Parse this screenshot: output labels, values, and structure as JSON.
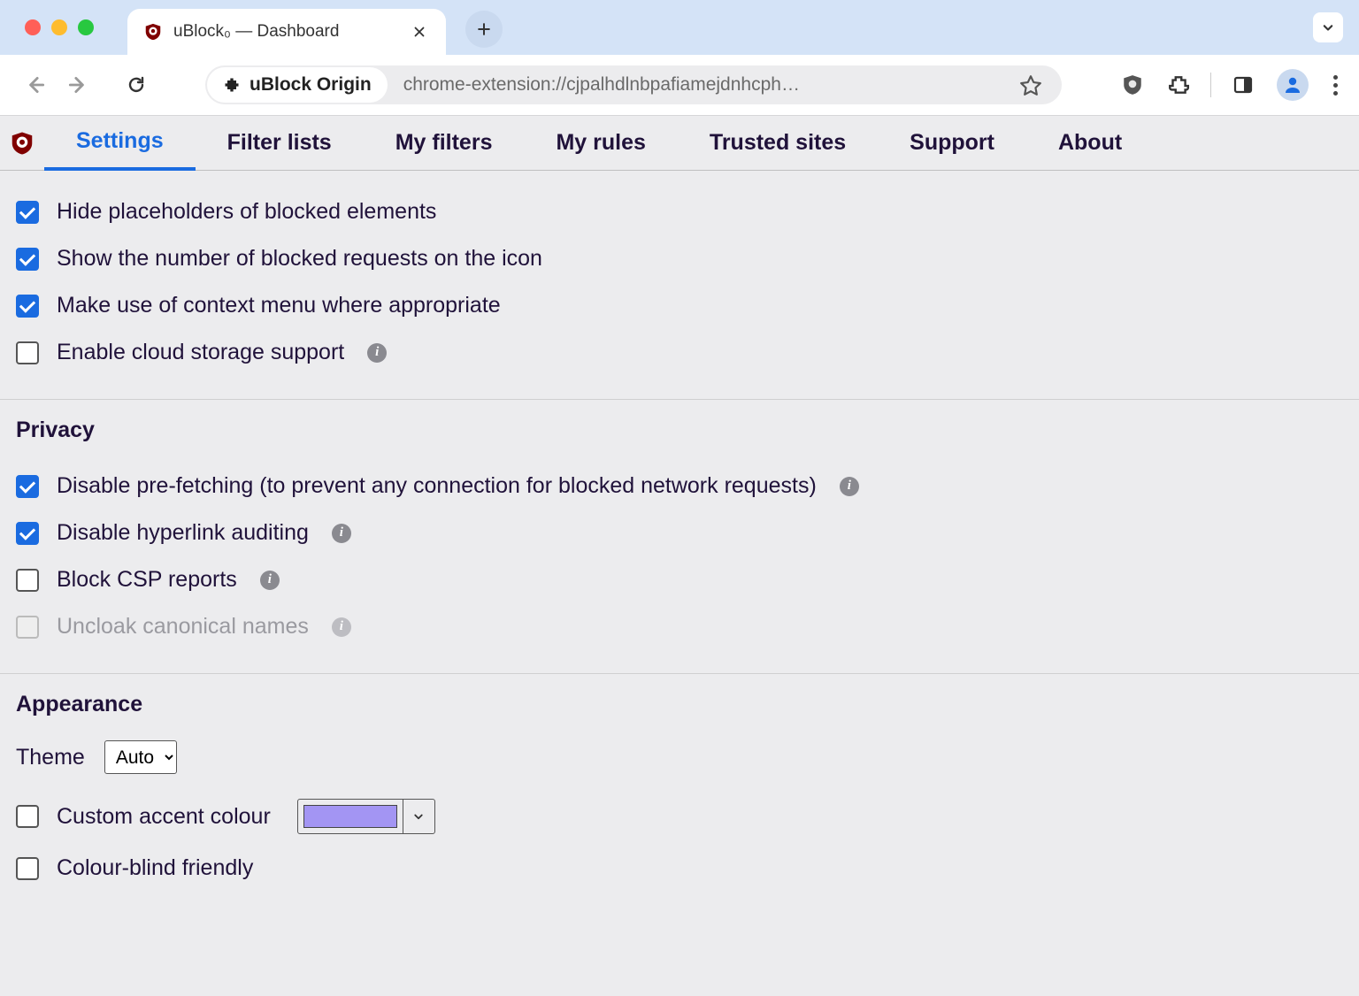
{
  "browser": {
    "tab_title": "uBlock₀ — Dashboard",
    "ext_chip_label": "uBlock Origin",
    "url": "chrome-extension://cjpalhdlnbpafiamejdnhcph…"
  },
  "dashboard": {
    "tabs": {
      "settings": "Settings",
      "filter_lists": "Filter lists",
      "my_filters": "My filters",
      "my_rules": "My rules",
      "trusted_sites": "Trusted sites",
      "support": "Support",
      "about": "About"
    }
  },
  "general": {
    "hide_placeholders": {
      "label": "Hide placeholders of blocked elements",
      "checked": true
    },
    "show_blocked_count": {
      "label": "Show the number of blocked requests on the icon",
      "checked": true
    },
    "context_menu": {
      "label": "Make use of context menu where appropriate",
      "checked": true
    },
    "cloud_storage": {
      "label": "Enable cloud storage support",
      "checked": false,
      "info": true
    }
  },
  "privacy": {
    "title": "Privacy",
    "disable_prefetching": {
      "label": "Disable pre-fetching (to prevent any connection for blocked network requests)",
      "checked": true,
      "info": true
    },
    "disable_hyperlink_auditing": {
      "label": "Disable hyperlink auditing",
      "checked": true,
      "info": true
    },
    "block_csp": {
      "label": "Block CSP reports",
      "checked": false,
      "info": true
    },
    "uncloak_canonical": {
      "label": "Uncloak canonical names",
      "checked": false,
      "info": true,
      "disabled": true
    }
  },
  "appearance": {
    "title": "Appearance",
    "theme_label": "Theme",
    "theme_value": "Auto",
    "custom_accent": {
      "label": "Custom accent colour",
      "checked": false,
      "swatch": "#a395f3"
    },
    "colour_blind": {
      "label": "Colour-blind friendly",
      "checked": false
    }
  }
}
